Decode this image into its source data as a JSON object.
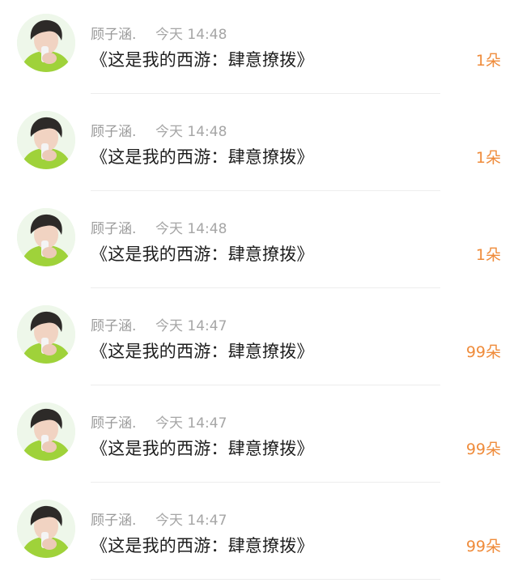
{
  "colors": {
    "count_accent": "#ef8b3a",
    "meta_text": "#9a9a9a",
    "title_text": "#1e1e1e"
  },
  "items": [
    {
      "avatar": "user-avatar",
      "username": "顾子涵.",
      "time": "今天 14:48",
      "title": "《这是我的西游：肆意撩拨》",
      "count": "1朵"
    },
    {
      "avatar": "user-avatar",
      "username": "顾子涵.",
      "time": "今天 14:48",
      "title": "《这是我的西游：肆意撩拨》",
      "count": "1朵"
    },
    {
      "avatar": "user-avatar",
      "username": "顾子涵.",
      "time": "今天 14:48",
      "title": "《这是我的西游：肆意撩拨》",
      "count": "1朵"
    },
    {
      "avatar": "user-avatar",
      "username": "顾子涵.",
      "time": "今天 14:47",
      "title": "《这是我的西游：肆意撩拨》",
      "count": "99朵"
    },
    {
      "avatar": "user-avatar",
      "username": "顾子涵.",
      "time": "今天 14:47",
      "title": "《这是我的西游：肆意撩拨》",
      "count": "99朵"
    },
    {
      "avatar": "user-avatar",
      "username": "顾子涵.",
      "time": "今天 14:47",
      "title": "《这是我的西游：肆意撩拨》",
      "count": "99朵"
    }
  ]
}
